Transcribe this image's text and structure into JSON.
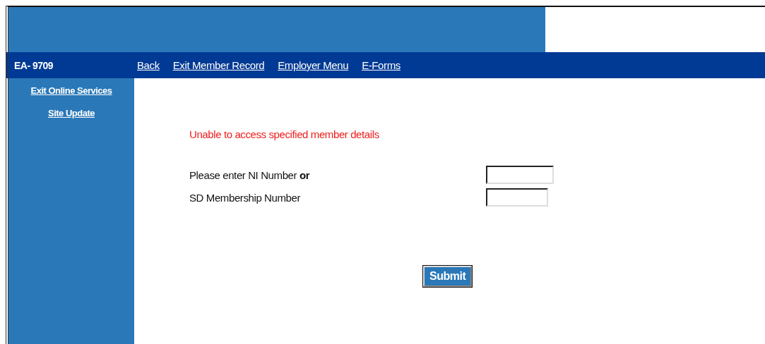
{
  "header": {
    "record_id": "EA- 9709",
    "nav_links": [
      "Back",
      "Exit Member Record",
      "Employer Menu",
      "E-Forms"
    ]
  },
  "sidebar": {
    "links": [
      "Exit Online Services",
      "Site Update"
    ]
  },
  "form": {
    "error": "Unable to access specified member details",
    "fields": [
      {
        "label": "Please enter NI Number **or**"
      },
      {
        "label": "SD Membership Number"
      }
    ],
    "submit": "Submit"
  }
}
